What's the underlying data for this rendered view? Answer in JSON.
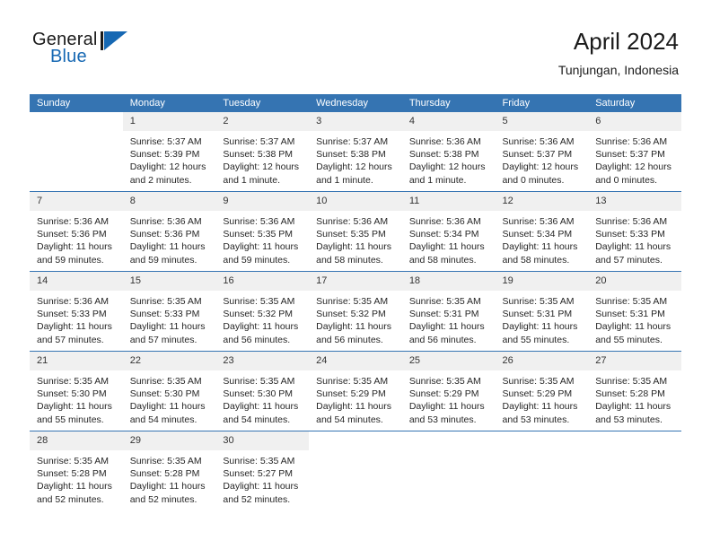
{
  "brand": {
    "name_top": "General",
    "name_bottom": "Blue",
    "accent_color": "#1668b3"
  },
  "header": {
    "title": "April 2024",
    "subtitle": "Tunjungan, Indonesia"
  },
  "theme": {
    "header_bg": "#3574b2",
    "daynum_bg": "#f0f0f0",
    "grid_line": "#3574b2"
  },
  "weekdays": [
    "Sunday",
    "Monday",
    "Tuesday",
    "Wednesday",
    "Thursday",
    "Friday",
    "Saturday"
  ],
  "labels": {
    "sunrise": "Sunrise:",
    "sunset": "Sunset:",
    "daylight": "Daylight:"
  },
  "weeks": [
    [
      {
        "day": "",
        "sunrise": "",
        "sunset": "",
        "daylight": "",
        "blank": true
      },
      {
        "day": "1",
        "sunrise": "Sunrise: 5:37 AM",
        "sunset": "Sunset: 5:39 PM",
        "daylight_1": "Daylight: 12 hours",
        "daylight_2": "and 2 minutes."
      },
      {
        "day": "2",
        "sunrise": "Sunrise: 5:37 AM",
        "sunset": "Sunset: 5:38 PM",
        "daylight_1": "Daylight: 12 hours",
        "daylight_2": "and 1 minute."
      },
      {
        "day": "3",
        "sunrise": "Sunrise: 5:37 AM",
        "sunset": "Sunset: 5:38 PM",
        "daylight_1": "Daylight: 12 hours",
        "daylight_2": "and 1 minute."
      },
      {
        "day": "4",
        "sunrise": "Sunrise: 5:36 AM",
        "sunset": "Sunset: 5:38 PM",
        "daylight_1": "Daylight: 12 hours",
        "daylight_2": "and 1 minute."
      },
      {
        "day": "5",
        "sunrise": "Sunrise: 5:36 AM",
        "sunset": "Sunset: 5:37 PM",
        "daylight_1": "Daylight: 12 hours",
        "daylight_2": "and 0 minutes."
      },
      {
        "day": "6",
        "sunrise": "Sunrise: 5:36 AM",
        "sunset": "Sunset: 5:37 PM",
        "daylight_1": "Daylight: 12 hours",
        "daylight_2": "and 0 minutes."
      }
    ],
    [
      {
        "day": "7",
        "sunrise": "Sunrise: 5:36 AM",
        "sunset": "Sunset: 5:36 PM",
        "daylight_1": "Daylight: 11 hours",
        "daylight_2": "and 59 minutes."
      },
      {
        "day": "8",
        "sunrise": "Sunrise: 5:36 AM",
        "sunset": "Sunset: 5:36 PM",
        "daylight_1": "Daylight: 11 hours",
        "daylight_2": "and 59 minutes."
      },
      {
        "day": "9",
        "sunrise": "Sunrise: 5:36 AM",
        "sunset": "Sunset: 5:35 PM",
        "daylight_1": "Daylight: 11 hours",
        "daylight_2": "and 59 minutes."
      },
      {
        "day": "10",
        "sunrise": "Sunrise: 5:36 AM",
        "sunset": "Sunset: 5:35 PM",
        "daylight_1": "Daylight: 11 hours",
        "daylight_2": "and 58 minutes."
      },
      {
        "day": "11",
        "sunrise": "Sunrise: 5:36 AM",
        "sunset": "Sunset: 5:34 PM",
        "daylight_1": "Daylight: 11 hours",
        "daylight_2": "and 58 minutes."
      },
      {
        "day": "12",
        "sunrise": "Sunrise: 5:36 AM",
        "sunset": "Sunset: 5:34 PM",
        "daylight_1": "Daylight: 11 hours",
        "daylight_2": "and 58 minutes."
      },
      {
        "day": "13",
        "sunrise": "Sunrise: 5:36 AM",
        "sunset": "Sunset: 5:33 PM",
        "daylight_1": "Daylight: 11 hours",
        "daylight_2": "and 57 minutes."
      }
    ],
    [
      {
        "day": "14",
        "sunrise": "Sunrise: 5:36 AM",
        "sunset": "Sunset: 5:33 PM",
        "daylight_1": "Daylight: 11 hours",
        "daylight_2": "and 57 minutes."
      },
      {
        "day": "15",
        "sunrise": "Sunrise: 5:35 AM",
        "sunset": "Sunset: 5:33 PM",
        "daylight_1": "Daylight: 11 hours",
        "daylight_2": "and 57 minutes."
      },
      {
        "day": "16",
        "sunrise": "Sunrise: 5:35 AM",
        "sunset": "Sunset: 5:32 PM",
        "daylight_1": "Daylight: 11 hours",
        "daylight_2": "and 56 minutes."
      },
      {
        "day": "17",
        "sunrise": "Sunrise: 5:35 AM",
        "sunset": "Sunset: 5:32 PM",
        "daylight_1": "Daylight: 11 hours",
        "daylight_2": "and 56 minutes."
      },
      {
        "day": "18",
        "sunrise": "Sunrise: 5:35 AM",
        "sunset": "Sunset: 5:31 PM",
        "daylight_1": "Daylight: 11 hours",
        "daylight_2": "and 56 minutes."
      },
      {
        "day": "19",
        "sunrise": "Sunrise: 5:35 AM",
        "sunset": "Sunset: 5:31 PM",
        "daylight_1": "Daylight: 11 hours",
        "daylight_2": "and 55 minutes."
      },
      {
        "day": "20",
        "sunrise": "Sunrise: 5:35 AM",
        "sunset": "Sunset: 5:31 PM",
        "daylight_1": "Daylight: 11 hours",
        "daylight_2": "and 55 minutes."
      }
    ],
    [
      {
        "day": "21",
        "sunrise": "Sunrise: 5:35 AM",
        "sunset": "Sunset: 5:30 PM",
        "daylight_1": "Daylight: 11 hours",
        "daylight_2": "and 55 minutes."
      },
      {
        "day": "22",
        "sunrise": "Sunrise: 5:35 AM",
        "sunset": "Sunset: 5:30 PM",
        "daylight_1": "Daylight: 11 hours",
        "daylight_2": "and 54 minutes."
      },
      {
        "day": "23",
        "sunrise": "Sunrise: 5:35 AM",
        "sunset": "Sunset: 5:30 PM",
        "daylight_1": "Daylight: 11 hours",
        "daylight_2": "and 54 minutes."
      },
      {
        "day": "24",
        "sunrise": "Sunrise: 5:35 AM",
        "sunset": "Sunset: 5:29 PM",
        "daylight_1": "Daylight: 11 hours",
        "daylight_2": "and 54 minutes."
      },
      {
        "day": "25",
        "sunrise": "Sunrise: 5:35 AM",
        "sunset": "Sunset: 5:29 PM",
        "daylight_1": "Daylight: 11 hours",
        "daylight_2": "and 53 minutes."
      },
      {
        "day": "26",
        "sunrise": "Sunrise: 5:35 AM",
        "sunset": "Sunset: 5:29 PM",
        "daylight_1": "Daylight: 11 hours",
        "daylight_2": "and 53 minutes."
      },
      {
        "day": "27",
        "sunrise": "Sunrise: 5:35 AM",
        "sunset": "Sunset: 5:28 PM",
        "daylight_1": "Daylight: 11 hours",
        "daylight_2": "and 53 minutes."
      }
    ],
    [
      {
        "day": "28",
        "sunrise": "Sunrise: 5:35 AM",
        "sunset": "Sunset: 5:28 PM",
        "daylight_1": "Daylight: 11 hours",
        "daylight_2": "and 52 minutes."
      },
      {
        "day": "29",
        "sunrise": "Sunrise: 5:35 AM",
        "sunset": "Sunset: 5:28 PM",
        "daylight_1": "Daylight: 11 hours",
        "daylight_2": "and 52 minutes."
      },
      {
        "day": "30",
        "sunrise": "Sunrise: 5:35 AM",
        "sunset": "Sunset: 5:27 PM",
        "daylight_1": "Daylight: 11 hours",
        "daylight_2": "and 52 minutes."
      },
      {
        "day": "",
        "sunrise": "",
        "sunset": "",
        "daylight": "",
        "blank": true
      },
      {
        "day": "",
        "sunrise": "",
        "sunset": "",
        "daylight": "",
        "blank": true
      },
      {
        "day": "",
        "sunrise": "",
        "sunset": "",
        "daylight": "",
        "blank": true
      },
      {
        "day": "",
        "sunrise": "",
        "sunset": "",
        "daylight": "",
        "blank": true
      }
    ]
  ]
}
